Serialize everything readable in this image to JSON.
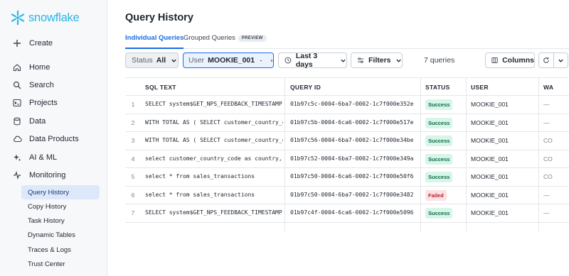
{
  "brand": {
    "name": "snowflake",
    "color": "#29b5e8"
  },
  "sidebar": {
    "items": [
      {
        "label": "Create",
        "icon": "plus-icon"
      },
      {
        "label": "Home",
        "icon": "home-icon"
      },
      {
        "label": "Search",
        "icon": "search-icon"
      },
      {
        "label": "Projects",
        "icon": "terminal-icon"
      },
      {
        "label": "Data",
        "icon": "database-icon"
      },
      {
        "label": "Data Products",
        "icon": "cloud-icon"
      },
      {
        "label": "AI & ML",
        "icon": "sparkle-icon"
      },
      {
        "label": "Monitoring",
        "icon": "activity-icon"
      }
    ],
    "sub_items": [
      {
        "label": "Query History",
        "active": true
      },
      {
        "label": "Copy History"
      },
      {
        "label": "Task History"
      },
      {
        "label": "Dynamic Tables"
      },
      {
        "label": "Traces & Logs"
      },
      {
        "label": "Trust Center"
      }
    ]
  },
  "page": {
    "title": "Query History",
    "tabs": [
      {
        "label": "Individual Queries",
        "active": true
      },
      {
        "label": "Grouped Queries",
        "badge": "PREVIEW"
      }
    ]
  },
  "toolbar": {
    "status_label": "Status",
    "status_value": "All",
    "user_label": "User",
    "user_value": "MOOKIE_001",
    "date_range": "Last 3 days",
    "filters_label": "Filters",
    "query_count": "7 queries",
    "columns_label": "Columns"
  },
  "table": {
    "headers": [
      "SQL TEXT",
      "QUERY ID",
      "STATUS",
      "USER",
      "WA"
    ],
    "rows": [
      {
        "num": "1",
        "sql": "SELECT system$GET_NPS_FEEDBACK_TIMESTAMP()",
        "qid": "01b97c5c-0004-6ba7-0002-1c7f000e352e",
        "status": "Success",
        "user": "MOOKIE_001",
        "wh": "—"
      },
      {
        "num": "2",
        "sql": "WITH TOTAL AS ( SELECT customer_country_code",
        "qid": "01b97c5b-0004-6ca6-0002-1c7f000e517e",
        "status": "Success",
        "user": "MOOKIE_001",
        "wh": "—"
      },
      {
        "num": "3",
        "sql": "WITH TOTAL AS ( SELECT customer_country_code",
        "qid": "01b97c56-0004-6ba7-0002-1c7f000e34be",
        "status": "Success",
        "user": "MOOKIE_001",
        "wh": "CO"
      },
      {
        "num": "4",
        "sql": "select customer_country_code as country, to",
        "qid": "01b97c52-0004-6ba7-0002-1c7f000e349a",
        "status": "Success",
        "user": "MOOKIE_001",
        "wh": "CO"
      },
      {
        "num": "5",
        "sql": "select * from sales_transactions",
        "qid": "01b97c50-0004-6ca6-0002-1c7f000e50f6",
        "status": "Success",
        "user": "MOOKIE_001",
        "wh": "CO"
      },
      {
        "num": "6",
        "sql": "select * from sales_transactions",
        "qid": "01b97c50-0004-6ba7-0002-1c7f000e3482",
        "status": "Failed",
        "user": "MOOKIE_001",
        "wh": "—"
      },
      {
        "num": "7",
        "sql": "SELECT system$GET_NPS_FEEDBACK_TIMESTAMP()",
        "qid": "01b97c4f-0004-6ca6-0002-1c7f000e5096",
        "status": "Success",
        "user": "MOOKIE_001",
        "wh": "—"
      }
    ]
  }
}
